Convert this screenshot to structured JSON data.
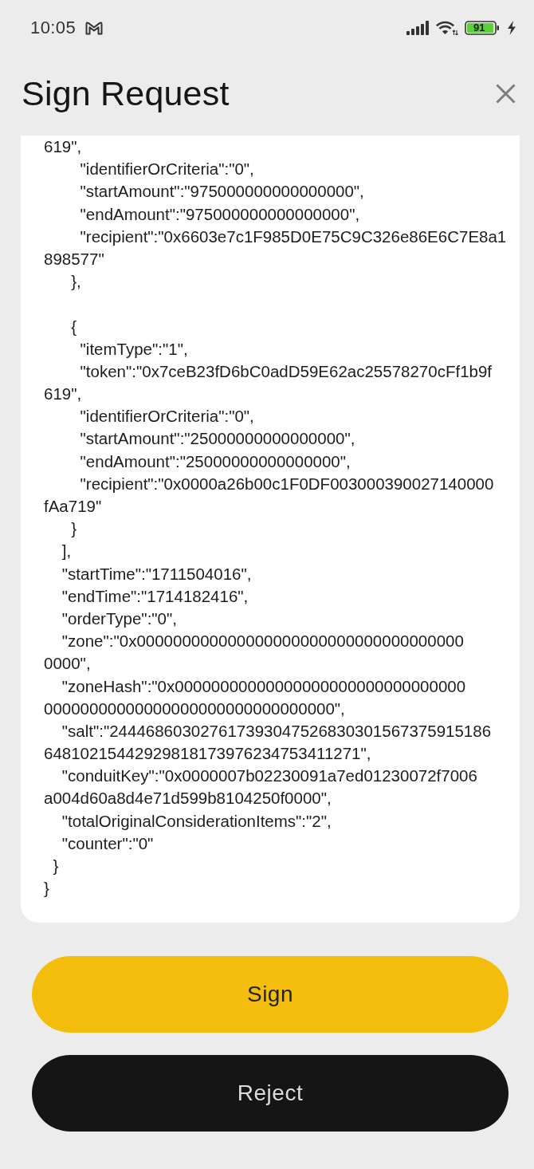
{
  "status_bar": {
    "time": "10:05",
    "battery": "91"
  },
  "header": {
    "title": "Sign Request"
  },
  "message": {
    "blocks": [
      [
        "619\",",
        "        \"identifierOrCriteria\":\"0\",",
        "        \"startAmount\":\"975000000000000000\",",
        "        \"endAmount\":\"975000000000000000\",",
        "        \"recipient\":\"0x6603e7c1F985D0E75C9C326e86E6C7E8a1",
        "898577\"",
        "      },"
      ],
      [
        "      {",
        "        \"itemType\":\"1\",",
        "        \"token\":\"0x7ceB23fD6bC0adD59E62ac25578270cFf1b9f",
        "619\",",
        "        \"identifierOrCriteria\":\"0\",",
        "        \"startAmount\":\"25000000000000000\",",
        "        \"endAmount\":\"25000000000000000\",",
        "        \"recipient\":\"0x0000a26b00c1F0DF003000390027140000",
        "fAa719\"",
        "      }",
        "    ],",
        "    \"startTime\":\"1711504016\",",
        "    \"endTime\":\"1714182416\",",
        "    \"orderType\":\"0\",",
        "    \"zone\":\"0x000000000000000000000000000000000000",
        "0000\",",
        "    \"zoneHash\":\"0x00000000000000000000000000000000",
        "00000000000000000000000000000000\",",
        "    \"salt\":\"244468603027617393047526830301567375915186",
        "64810215442929818173976234753411271\",",
        "    \"conduitKey\":\"0x0000007b02230091a7ed01230072f7006",
        "a004d60a8d4e71d599b8104250f0000\",",
        "    \"totalOriginalConsiderationItems\":\"2\",",
        "    \"counter\":\"0\"",
        "  }",
        "}"
      ]
    ]
  },
  "buttons": [
    {
      "label": "Sign",
      "kind": "confirm"
    },
    {
      "label": "Reject",
      "kind": "reject"
    }
  ]
}
